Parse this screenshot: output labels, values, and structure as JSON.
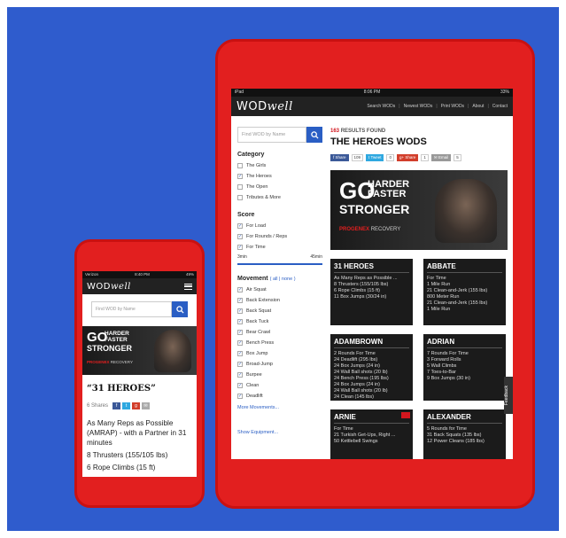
{
  "tablet": {
    "status": {
      "left": "iPad",
      "center": "8:06 PM",
      "right": "33%"
    },
    "logo_a": "WOD",
    "logo_b": "well",
    "nav": [
      "Search WODs",
      "Newest WODs",
      "Print WODs",
      "About",
      "Contact"
    ],
    "search_placeholder": "Find WOD by Name",
    "category": {
      "title": "Category",
      "items": [
        "The Girls",
        "The Heroes",
        "The Open",
        "Tributes & More"
      ],
      "checked": [
        false,
        true,
        false,
        false
      ]
    },
    "score": {
      "title": "Score",
      "items": [
        "For Load",
        "For Rounds / Reps",
        "For Time"
      ],
      "slider_min": "3min",
      "slider_max": "45min",
      "slider_fill": 1.0
    },
    "movement": {
      "title": "Movement",
      "links": "( all | none )",
      "items": [
        "Air Squat",
        "Back Extension",
        "Back Squat",
        "Back Tuck",
        "Bear Crawl",
        "Bench Press",
        "Box Jump",
        "Broad-Jump",
        "Burpee",
        "Clean",
        "Deadlift"
      ],
      "more": "More Movements..."
    },
    "show_equipment": "Show Equipment...",
    "results_count": "163",
    "results_label": "RESULTS FOUND",
    "heading": "THE HEROES WODS",
    "share": {
      "fb": "Share",
      "fb_count": "109",
      "tw": "Tweet",
      "tw_count": "0",
      "gp": "Share",
      "gp_count": "1",
      "email": "Email",
      "email_count": "5"
    },
    "banner": {
      "go": "GO",
      "harder": "HARDER",
      "faster": "FASTER",
      "stronger": "STRONGER",
      "brand": "PROGENEX",
      "brand2": "RECOVERY"
    },
    "cards": [
      {
        "title": "31 HEROES",
        "lines": [
          "As Many Reps as Possible ...",
          "8 Thrusters (155/105 lbs)",
          "6 Rope Climbs (15 ft)",
          "11 Box Jumps (30/24 in)"
        ]
      },
      {
        "title": "ABBATE",
        "lines": [
          "For Time",
          "1 Mile Run",
          "21 Clean-and-Jerk (155 lbs)",
          "800 Meter Run",
          "21 Clean-and-Jerk (155 lbs)",
          "1 Mile Run"
        ]
      },
      {
        "title": "ADAMBROWN",
        "lines": [
          "2 Rounds For Time",
          "24 Deadlift (295 lbs)",
          "24 Box Jumps (24 in)",
          "24 Wall Ball shots (20 lb)",
          "24 Bench Press (195 lbs)",
          "24 Box Jumps (24 in)",
          "24 Wall Ball shots (20 lb)",
          "24 Clean (145 lbs)"
        ]
      },
      {
        "title": "ADRIAN",
        "lines": [
          "7 Rounds For Time",
          "3 Forward Rolls",
          "5 Wall Climbs",
          "7 Toes-to-Bar",
          "9 Box Jumps (30 in)"
        ]
      },
      {
        "title": "ARNIE",
        "lines": [
          "For Time",
          "21 Turkish Get-Ups, Right ...",
          "50 Kettlebell Swings"
        ]
      },
      {
        "title": "ALEXANDER",
        "lines": [
          "5 Rounds for Time",
          "31 Back Squats (135 lbs)",
          "12 Power Cleans (185 lbs)"
        ]
      }
    ],
    "feedback": "Feedback"
  },
  "phone": {
    "status": {
      "left": "Verizon",
      "center": "8:40 PM",
      "right": "49%"
    },
    "search_placeholder": "Find WOD by Name",
    "title": "“31 HEROES”",
    "shares": "6 Shares",
    "body": [
      "As Many Reps as Possible (AMRAP) - with a Partner in 31 minutes",
      "8 Thrusters (155/105 lbs)",
      "6 Rope Climbs (15 ft)"
    ]
  },
  "colors": {
    "background": "#2f5ccd",
    "device": "#e21f1f",
    "accent": "#2a5ec4"
  }
}
